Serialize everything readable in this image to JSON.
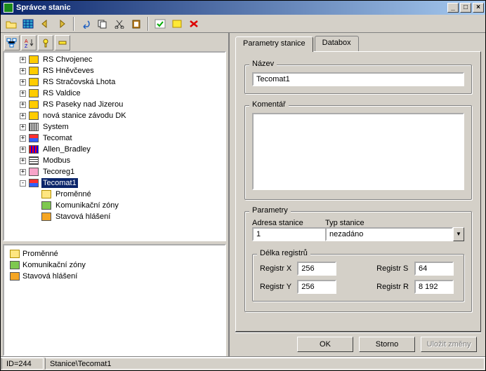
{
  "title": "Správce stanic",
  "toolbar": {
    "icons": [
      "open-icon",
      "table-icon",
      "back-icon",
      "forward-icon",
      "sep",
      "undo-icon",
      "copy-icon",
      "cut-icon",
      "paste-icon",
      "sep",
      "check-icon",
      "highlight-icon",
      "delete-icon"
    ]
  },
  "tree": {
    "items": [
      {
        "exp": "+",
        "icon": "ic-yellow",
        "label": "RS Chvojenec",
        "sel": false,
        "indent": 1
      },
      {
        "exp": "+",
        "icon": "ic-yellow",
        "label": "RS Hněvčeves",
        "sel": false,
        "indent": 1
      },
      {
        "exp": "+",
        "icon": "ic-yellow",
        "label": "RS Stračovská Lhota",
        "sel": false,
        "indent": 1
      },
      {
        "exp": "+",
        "icon": "ic-yellow",
        "label": "RS Valdice",
        "sel": false,
        "indent": 1
      },
      {
        "exp": "+",
        "icon": "ic-yellow",
        "label": "RS Paseky nad Jizerou",
        "sel": false,
        "indent": 1
      },
      {
        "exp": "+",
        "icon": "ic-yellow",
        "label": "nová stanice závodu DK",
        "sel": false,
        "indent": 1
      },
      {
        "exp": "+",
        "icon": "ic-grid",
        "label": "System",
        "sel": false,
        "indent": 1
      },
      {
        "exp": "+",
        "icon": "ic-teco",
        "label": "Tecomat",
        "sel": false,
        "indent": 1
      },
      {
        "exp": "+",
        "icon": "ic-ab",
        "label": "Allen_Bradley",
        "sel": false,
        "indent": 1
      },
      {
        "exp": "+",
        "icon": "ic-mod",
        "label": "Modbus",
        "sel": false,
        "indent": 1
      },
      {
        "exp": "+",
        "icon": "ic-pink",
        "label": "Tecoreg1",
        "sel": false,
        "indent": 1
      },
      {
        "exp": "-",
        "icon": "ic-teco",
        "label": "Tecomat1",
        "sel": true,
        "indent": 1
      },
      {
        "exp": "",
        "icon": "ic-folder",
        "label": "Proměnné",
        "sel": false,
        "indent": 2
      },
      {
        "exp": "",
        "icon": "ic-green",
        "label": "Komunikační zóny",
        "sel": false,
        "indent": 2
      },
      {
        "exp": "",
        "icon": "ic-orange",
        "label": "Stavová hlášení",
        "sel": false,
        "indent": 2
      }
    ]
  },
  "bottomlist": {
    "items": [
      {
        "icon": "ic-folder",
        "label": "Proměnné"
      },
      {
        "icon": "ic-green",
        "label": "Komunikační zóny"
      },
      {
        "icon": "ic-orange",
        "label": "Stavová hlášení"
      }
    ]
  },
  "tabs": {
    "active": "Parametry stanice",
    "items": [
      "Parametry stanice",
      "Databox"
    ]
  },
  "form": {
    "name_legend": "Název",
    "name_value": "Tecomat1",
    "comment_legend": "Komentář",
    "comment_value": "",
    "params_legend": "Parametry",
    "addr_label": "Adresa stanice",
    "addr_value": "1",
    "type_label": "Typ stanice",
    "type_value": "nezadáno",
    "reglen_legend": "Délka registrů",
    "regX_label": "Registr X",
    "regX": "256",
    "regY_label": "Registr Y",
    "regY": "256",
    "regS_label": "Registr S",
    "regS": "64",
    "regR_label": "Registr R",
    "regR": "8 192"
  },
  "buttons": {
    "ok": "OK",
    "cancel": "Storno",
    "save": "Uložit změny"
  },
  "status": {
    "id": "ID=244",
    "path": "Stanice\\Tecomat1"
  }
}
